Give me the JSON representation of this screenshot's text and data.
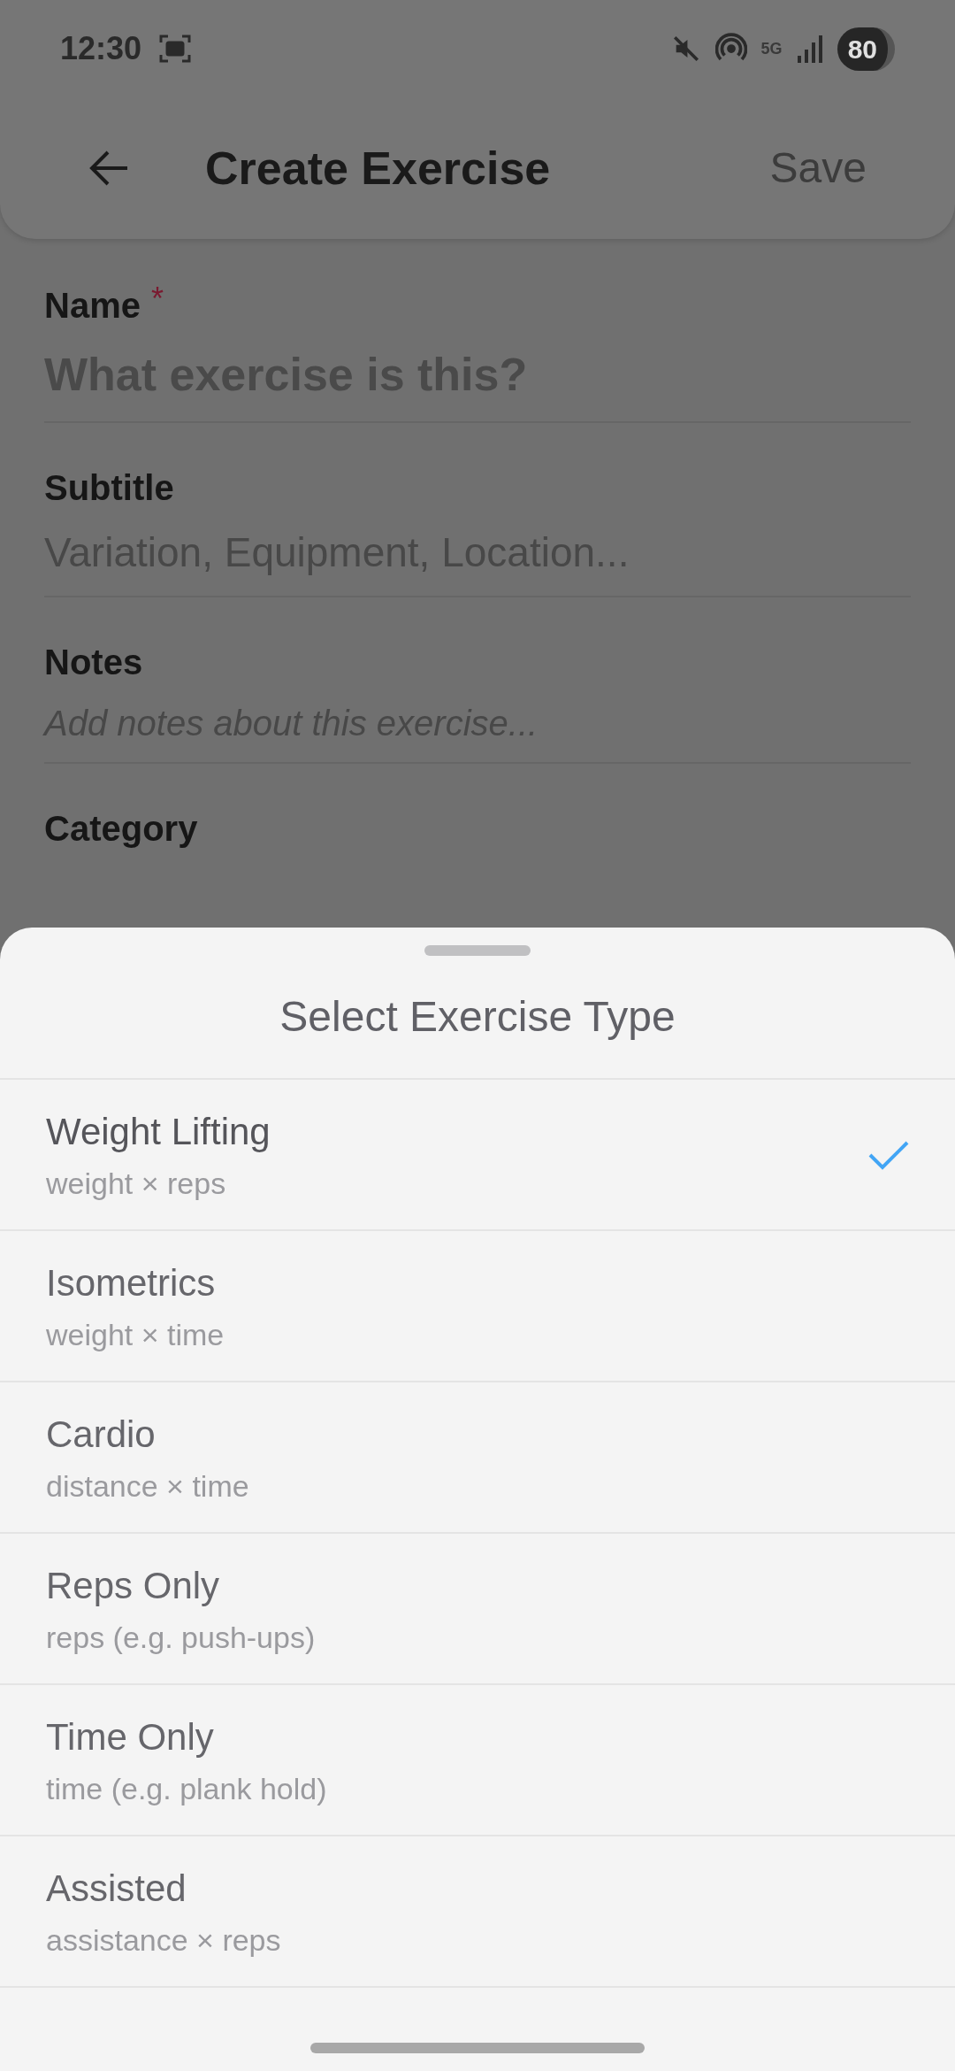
{
  "status_bar": {
    "time": "12:30",
    "network": "5G",
    "battery": "80"
  },
  "header": {
    "title": "Create Exercise",
    "action": "Save"
  },
  "form": {
    "fields": [
      {
        "kind": "title",
        "label": "Name",
        "required_mark": "*",
        "placeholder": "What exercise is this?"
      },
      {
        "kind": "text",
        "label": "Subtitle",
        "placeholder": "Variation, Equipment, Location..."
      },
      {
        "kind": "notes",
        "label": "Notes",
        "placeholder": "Add notes about this exercise..."
      },
      {
        "kind": "section",
        "label": "Category"
      }
    ]
  },
  "sheet": {
    "title": "Select Exercise Type",
    "options": [
      {
        "label": "Weight Lifting",
        "detail": "weight × reps",
        "selected": true
      },
      {
        "label": "Isometrics",
        "detail": "weight × time",
        "selected": false
      },
      {
        "label": "Cardio",
        "detail": "distance × time",
        "selected": false
      },
      {
        "label": "Reps Only",
        "detail": "reps (e.g. push-ups)",
        "selected": false
      },
      {
        "label": "Time Only",
        "detail": "time (e.g. plank hold)",
        "selected": false
      },
      {
        "label": "Assisted",
        "detail": "assistance × reps",
        "selected": false
      }
    ]
  }
}
